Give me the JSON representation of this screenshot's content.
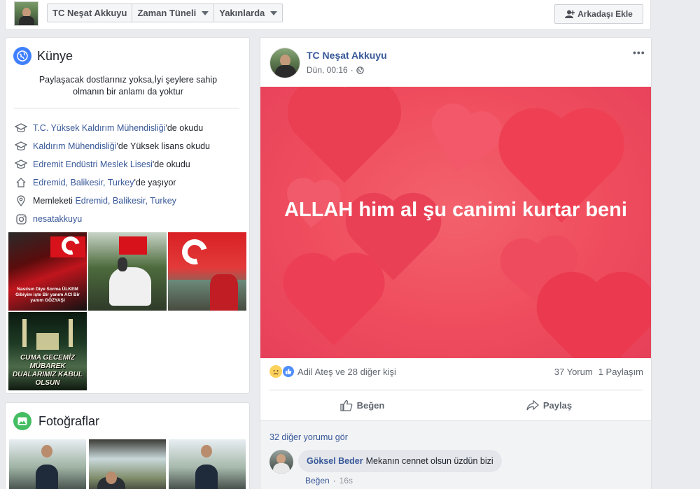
{
  "topbar": {
    "nav": [
      {
        "label": "TC Neşat Akkuyu",
        "caret": false
      },
      {
        "label": "Zaman Tüneli",
        "caret": true
      },
      {
        "label": "Yakınlarda",
        "caret": true
      }
    ],
    "add_friend_label": "Arkadaşı Ekle",
    "add_friend_icon": "add-friend-icon"
  },
  "intro": {
    "title": "Künye",
    "icon": "globe-icon",
    "bio": "Paylaşacak dostlarınız yoksa,İyi şeylere sahip olmanın bir anlamı da yoktur",
    "facts": [
      {
        "icon": "graduation-cap-icon",
        "link": "T.C. Yüksek Kaldırım Mühendisliği",
        "rest": "'de okudu"
      },
      {
        "icon": "graduation-cap-icon",
        "link": "Kaldırım Mühendisliği",
        "rest": "'de Yüksek lisans okudu"
      },
      {
        "icon": "graduation-cap-icon",
        "link": "Edremit Endüstri Meslek Lisesi",
        "rest": "'de okudu"
      },
      {
        "icon": "home-icon",
        "link": "Edremid, Balikesir, Turkey",
        "rest": "'de yaşıyor"
      },
      {
        "icon": "location-pin-icon",
        "prefix": "Memleketi ",
        "link": "Edremid, Balikesir, Turkey",
        "rest": ""
      },
      {
        "icon": "instagram-icon",
        "link": "nesatakkuyu",
        "rest": ""
      }
    ],
    "photo_captions": {
      "photo1": "Nasılsın Diye Sorma ÜLKEM Gibiyim işte Bir yanım ACI Bir yanım GÖZYAŞI",
      "photo4": "CUMA GECEMİZ MÜBAREK DUALARIMIZ KABUL OLSUN"
    }
  },
  "photos_card": {
    "title": "Fotoğraflar",
    "icon": "photo-icon"
  },
  "post": {
    "author": "TC Neşat Akkuyu",
    "time": "Dün, 00:16",
    "privacy_icon": "globe-icon",
    "menu_icon": "more-dots-icon",
    "banner_text": "ALLAH him al şu canimi kurtar beni",
    "banner_color": "#ef4d5e",
    "reactions_text": "Adil Ateş ve 28 diğer kişi",
    "comments_count": "37 Yorum",
    "shares_count": "1 Paylaşım",
    "like_label": "Beğen",
    "share_label": "Paylaş"
  },
  "comments": {
    "more_label": "32 diğer yorumu gör",
    "items": [
      {
        "author": "Göksel Beder",
        "text": "Mekanın cennet olsun üzdün bizi",
        "like_label": "Beğen",
        "time": "16s"
      }
    ]
  }
}
